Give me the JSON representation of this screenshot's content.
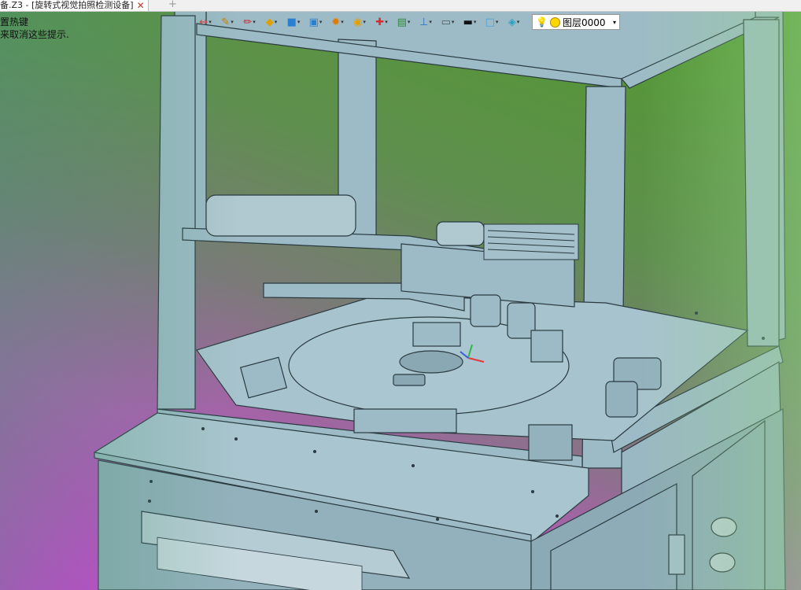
{
  "tab": {
    "title": "备.Z3 - [旋转式视觉拍照检测设备]",
    "close_glyph": "✕",
    "new_tab_glyph": "+"
  },
  "hint": {
    "line1": "置热键",
    "line2": "来取消这些提示."
  },
  "toolbar": {
    "tools": [
      {
        "name": "move-icon",
        "glyph": "↔",
        "color": "#d04040"
      },
      {
        "name": "point-icon",
        "glyph": "✎",
        "color": "#d07a00"
      },
      {
        "name": "sketch-icon",
        "glyph": "✏",
        "color": "#c03030"
      },
      {
        "name": "box-layer-icon",
        "glyph": "◆",
        "color": "#e0a000"
      },
      {
        "name": "solid-cube-icon",
        "glyph": "■",
        "color": "#2a7fd0"
      },
      {
        "name": "shape-icon",
        "glyph": "▣",
        "color": "#2a7fd0"
      },
      {
        "name": "render-icon",
        "glyph": "✹",
        "color": "#e07a00"
      },
      {
        "name": "view-icon",
        "glyph": "◉",
        "color": "#e0a000"
      },
      {
        "name": "transform-icon",
        "glyph": "✚",
        "color": "#d03030"
      },
      {
        "name": "image-icon",
        "glyph": "▤",
        "color": "#2a8a3a"
      },
      {
        "name": "dimension-icon",
        "glyph": "⊥",
        "color": "#2a70c0"
      },
      {
        "name": "monitor-icon",
        "glyph": "▭",
        "color": "#555555"
      },
      {
        "name": "line-style-icon",
        "glyph": "▬",
        "color": "#111111"
      },
      {
        "name": "color-swatch-icon",
        "glyph": "□",
        "color": "#4aa0d8"
      },
      {
        "name": "layer-stack-icon",
        "glyph": "◈",
        "color": "#2aa0c0"
      }
    ],
    "layer": {
      "name": "图层0000",
      "bulb_glyph": "💡",
      "dropdown_glyph": "▾"
    }
  },
  "colors": {
    "steel": "#9dbbc6",
    "steel_dark": "#6c8a96",
    "edge": "#2a3a40"
  }
}
